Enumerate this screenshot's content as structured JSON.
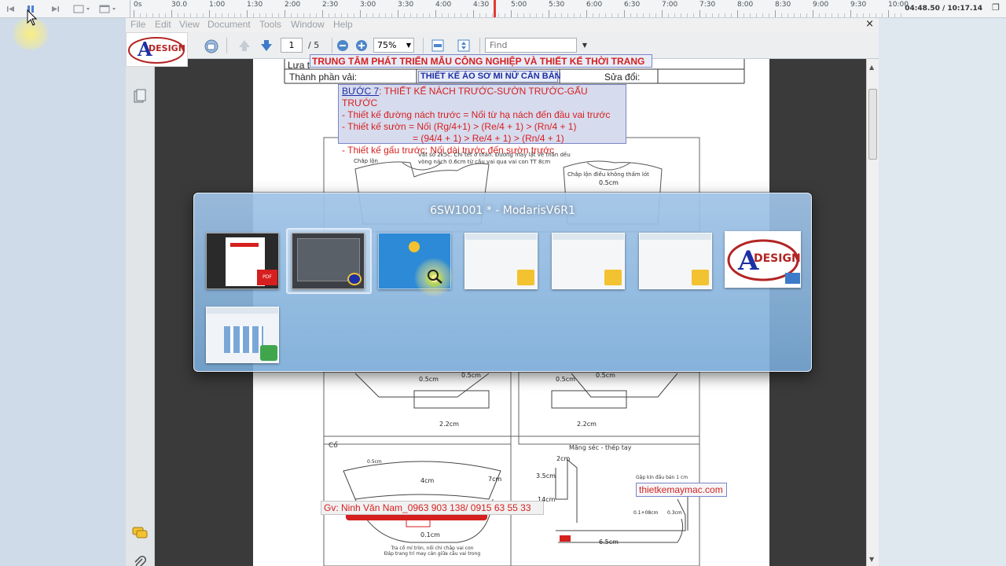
{
  "recorder": {
    "ticks": [
      "0s",
      "30.0",
      "1:00",
      "1:30",
      "2:00",
      "2:30",
      "3:00",
      "3:30",
      "4:00",
      "4:30",
      "5:00",
      "5:30",
      "6:00",
      "6:30",
      "7:00",
      "7:30",
      "8:00",
      "8:30",
      "9:00",
      "9:30",
      "10:00"
    ],
    "time_readout": "04:48.50 / 10:17.14",
    "icons": [
      "skip-back-icon",
      "pause-icon",
      "skip-forward-icon",
      "screen-icon",
      "window-icon"
    ]
  },
  "menu": {
    "items": [
      "File",
      "Edit",
      "View",
      "Document",
      "Tools",
      "Window",
      "Help"
    ],
    "close": "×"
  },
  "toolbar": {
    "page_current": "1",
    "page_total": "/ 5",
    "zoom": "75%",
    "find_placeholder": "Find"
  },
  "document": {
    "header_left_1": "Lưa t",
    "header_left_2": "Thành phần vải:",
    "header_right": "Sửa đổi:",
    "banner_center": "TRUNG TÂM PHÁT TRIỂN MẪU CÔNG NGHIỆP VÀ THIẾT KẾ THỜI TRANG",
    "banner_title": "THIẾT KẾ ÁO SƠ MI NỮ CĂN BẢN",
    "step_heading_prefix": "BƯỚC 7",
    "step_heading_rest": ": THIẾT KẾ NÁCH TRƯỚC-SƯỜN TRƯỚC-GẤU TRƯỚC",
    "step_lines": [
      "- Thiết kế đường nách trước = Nối từ hạ nách đến đầu vai trước",
      "- Thiết kế sườn = Nối (Rg/4+1) > (Re/4 + 1) > (Rn/4 + 1)",
      "= (94/4 + 1)      > Re/4 + 1) > (Rn/4 + 1)",
      "- Thiết kế gấu trước: Nối dài trước đến sườn trước"
    ],
    "sketch_note": "Vắt sổ 2k5c. Chỉ tết ở thân. Đường may lật về thân dều vòng nách 0.6cm từ cầu vai qua vai con TT 8cm",
    "chap_lon": "Chắp lộn",
    "chap_lon_2": "Chắp lộn điều không thấm lót",
    "dim_05": "0.5cm",
    "collar_label": "Cổ",
    "cuff_label": "Măng séc - thép tay",
    "dim_22": "2.2cm",
    "dim_2cm": "2cm",
    "dim_35": "3.5cm",
    "dim_14": "14cm",
    "dim_4cm": "4cm",
    "dim_7cm": "7cm",
    "dim_65": "6.5cm",
    "dim_01": "0.1cm",
    "dim_01_08": "0.1+08cm",
    "dim_03": "0.3cm",
    "gap_note": "Gập kín đầu bản 1 cm",
    "collar_note": "Tra cổ mí tròn, nối chỉ chắp vai con\nĐáp trang trí may cán giữa cầu vai trong",
    "caption_teacher": "Gv: Ninh Văn Nam_0963 903 138/ 0915 63 55 33",
    "caption_site": "thietkemaymac.com"
  },
  "switcher": {
    "title": "6SW1001 * - ModarisV6R1",
    "windows": [
      {
        "name": "pdf-reader-window",
        "kind": "pdf"
      },
      {
        "name": "modaris-window",
        "kind": "cad"
      },
      {
        "name": "camtasia-window",
        "kind": "blue"
      },
      {
        "name": "explorer-window-1",
        "kind": "folder"
      },
      {
        "name": "explorer-window-2",
        "kind": "folder"
      },
      {
        "name": "explorer-window-3",
        "kind": "folder"
      },
      {
        "name": "azdesign-logo-window",
        "kind": "logo"
      },
      {
        "name": "control-panel-window",
        "kind": "control"
      }
    ]
  },
  "colors": {
    "accent_red": "#d61f1f",
    "banner_border": "#7a86c6",
    "switcher_blue": "#8cb4dc",
    "playhead": "#e53935"
  }
}
